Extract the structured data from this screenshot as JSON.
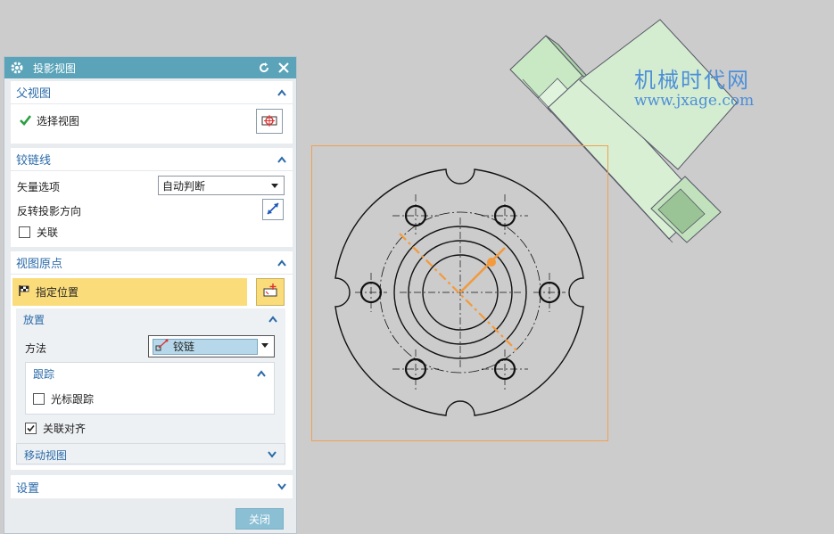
{
  "dialog": {
    "title": "投影视图",
    "parent_view": {
      "header": "父视图",
      "select_view_label": "选择视图"
    },
    "hinge_line": {
      "header": "铰链线",
      "vector_option_label": "矢量选项",
      "vector_option_value": "自动判断",
      "reverse_direction_label": "反转投影方向",
      "associative_label": "关联"
    },
    "view_origin": {
      "header": "视图原点",
      "specify_location_label": "指定位置",
      "placement": {
        "header": "放置",
        "method_label": "方法",
        "method_value": "铰链",
        "tracking": {
          "header": "跟踪",
          "cursor_tracking_label": "光标跟踪"
        },
        "associative_align_label": "关联对齐"
      },
      "move_view_header": "移动视图"
    },
    "settings_header": "设置",
    "close_label": "关闭"
  },
  "watermark": {
    "line1": "机械时代网",
    "line2": "www.jxage.com"
  },
  "colors": {
    "titlebar": "#5aa3b8",
    "section_header_text": "#2a6aa8",
    "highlight_row": "#fbdc7a",
    "preview_border": "#f0a050",
    "hinge_line": "#f39a3c",
    "model_green": "#c9e8c4"
  },
  "checkboxes": {
    "associative": false,
    "cursor_tracking": false,
    "associative_align": true
  }
}
